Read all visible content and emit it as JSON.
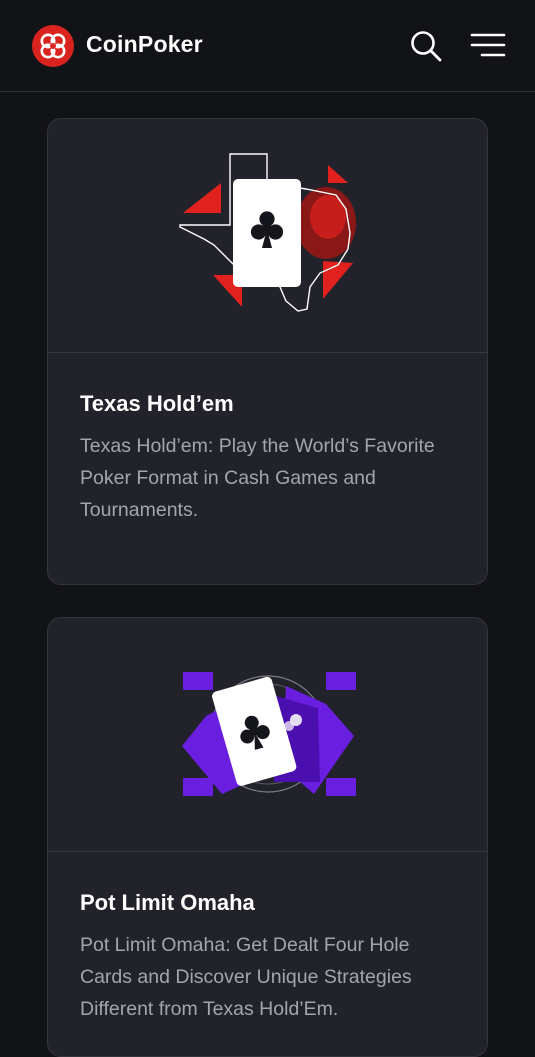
{
  "header": {
    "brand": "CoinPoker",
    "logo_icon": "coinpoker-logo-icon",
    "search_icon": "search-icon",
    "menu_icon": "hamburger-menu-icon"
  },
  "colors": {
    "background": "#121317",
    "card_background": "#22232a",
    "brand_red": "#d8231f",
    "holdem_accent": "#e0211e",
    "omaha_accent": "#6a1ee0"
  },
  "games": [
    {
      "title": "Texas Hold’em",
      "description": "Texas Hold’em: Play the World’s Favorite Poker Format in Cash Games and Tournaments.",
      "art_icon": "texas-map-club-card-icon"
    },
    {
      "title": "Pot Limit Omaha",
      "description": "Pot Limit Omaha: Get Dealt Four Hole Cards and Discover Unique Strategies Different from Texas Hold’Em.",
      "art_icon": "omaha-cards-club-icon"
    }
  ]
}
